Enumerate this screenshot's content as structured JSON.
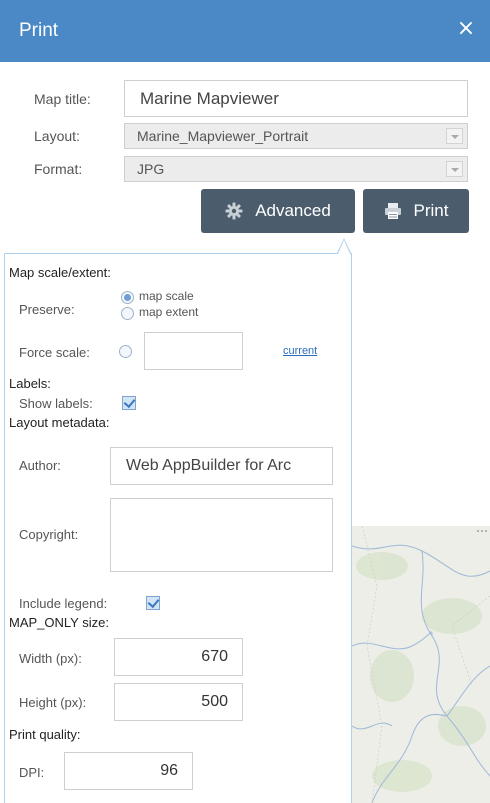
{
  "header": {
    "title": "Print",
    "close_glyph": "×"
  },
  "form": {
    "map_title_label": "Map title:",
    "map_title_value": "Marine Mapviewer",
    "layout_label": "Layout:",
    "layout_value": "Marine_Mapviewer_Portrait",
    "format_label": "Format:",
    "format_value": "JPG"
  },
  "buttons": {
    "advanced_label": "Advanced",
    "print_label": "Print"
  },
  "advanced": {
    "scale_extent_heading": "Map scale/extent:",
    "preserve_label": "Preserve:",
    "preserve_options": [
      "map scale",
      "map extent"
    ],
    "preserve_selected": "map scale",
    "force_scale_label": "Force scale:",
    "force_scale_value": "",
    "current_link": "current",
    "labels_heading": "Labels:",
    "show_labels_label": "Show labels:",
    "show_labels_checked": true,
    "layout_metadata_heading": "Layout metadata:",
    "author_label": "Author:",
    "author_value": "Web AppBuilder for Arc",
    "copyright_label": "Copyright:",
    "copyright_value": "",
    "include_legend_label": "Include legend:",
    "include_legend_checked": true,
    "map_only_heading": "MAP_ONLY size:",
    "width_label": "Width (px):",
    "width_value": "670",
    "height_label": "Height (px):",
    "height_value": "500",
    "print_quality_heading": "Print quality:",
    "dpi_label": "DPI:",
    "dpi_value": "96"
  },
  "colors": {
    "header_bg": "#4a88c6",
    "button_bg": "#4b5c6c",
    "panel_border": "#aed2ee",
    "link": "#2a6ebb"
  },
  "icons": {
    "close": "close-icon",
    "advanced": "gear-icon",
    "print": "printer-icon"
  }
}
